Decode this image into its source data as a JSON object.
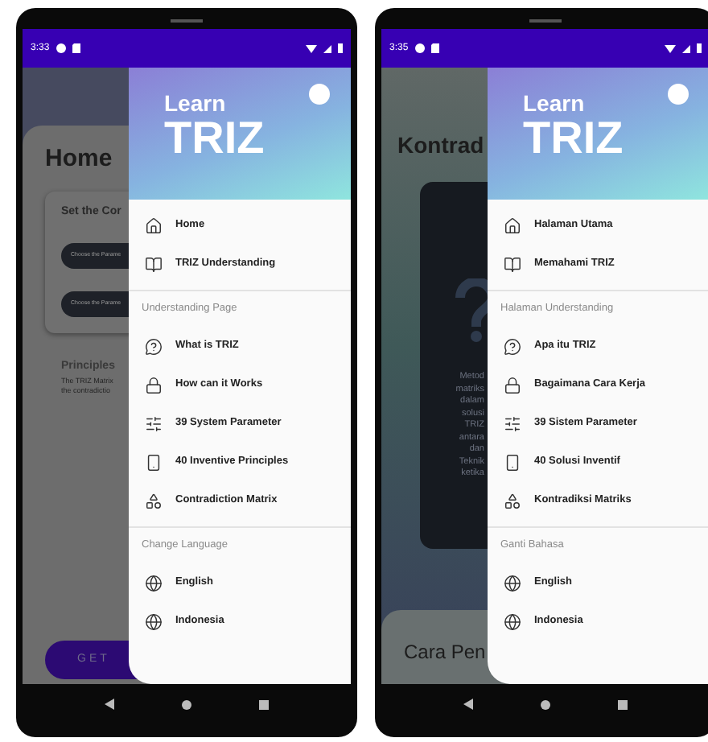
{
  "phones": [
    {
      "status_time": "3:33",
      "background": {
        "kind": "home",
        "title": "Home",
        "card_title": "Set the Cor",
        "card_buttons": [
          "Choose the Parame",
          "Choose the Parame"
        ],
        "section_title": "Principles",
        "section_lines": [
          "The TRIZ Matrix",
          "the contradictio"
        ],
        "action_button": "GET"
      },
      "drawer": {
        "brand_top": "Learn",
        "brand_main": "TRIZ",
        "sections": [
          {
            "items": [
              {
                "kind": "home",
                "label": "Home"
              },
              {
                "kind": "book",
                "label": "TRIZ Understanding"
              }
            ]
          },
          {
            "header": "Understanding Page",
            "items": [
              {
                "kind": "question",
                "label": "What is TRIZ"
              },
              {
                "kind": "lock",
                "label": "How can it Works"
              },
              {
                "kind": "sliders",
                "label": "39 System Parameter"
              },
              {
                "kind": "principles",
                "label": "40 Inventive Principles"
              },
              {
                "kind": "matrix",
                "label": "Contradiction Matrix"
              }
            ]
          },
          {
            "header": "Change Language",
            "items": [
              {
                "kind": "globe",
                "label": "English"
              },
              {
                "kind": "globe",
                "label": "Indonesia"
              }
            ]
          }
        ]
      }
    },
    {
      "status_time": "3:35",
      "background": {
        "kind": "matrix",
        "title": "Kontrad",
        "paragraph_lines": [
          "Metod",
          "matriks",
          "dalam",
          "solusi",
          "TRIZ",
          "antara",
          "dan",
          "Teknik",
          "ketika"
        ],
        "bottom_title": "Cara Pen"
      },
      "drawer": {
        "brand_top": "Learn",
        "brand_main": "TRIZ",
        "sections": [
          {
            "items": [
              {
                "kind": "home",
                "label": "Halaman Utama"
              },
              {
                "kind": "book",
                "label": "Memahami TRIZ"
              }
            ]
          },
          {
            "header": "Halaman Understanding",
            "items": [
              {
                "kind": "question",
                "label": "Apa itu TRIZ"
              },
              {
                "kind": "lock",
                "label": "Bagaimana Cara Kerja"
              },
              {
                "kind": "sliders",
                "label": "39 Sistem Parameter"
              },
              {
                "kind": "principles",
                "label": "40 Solusi Inventif"
              },
              {
                "kind": "matrix",
                "label": "Kontradiksi Matriks"
              }
            ]
          },
          {
            "header": "Ganti Bahasa",
            "items": [
              {
                "kind": "globe",
                "label": "English"
              },
              {
                "kind": "globe",
                "label": "Indonesia"
              }
            ]
          }
        ]
      }
    }
  ]
}
